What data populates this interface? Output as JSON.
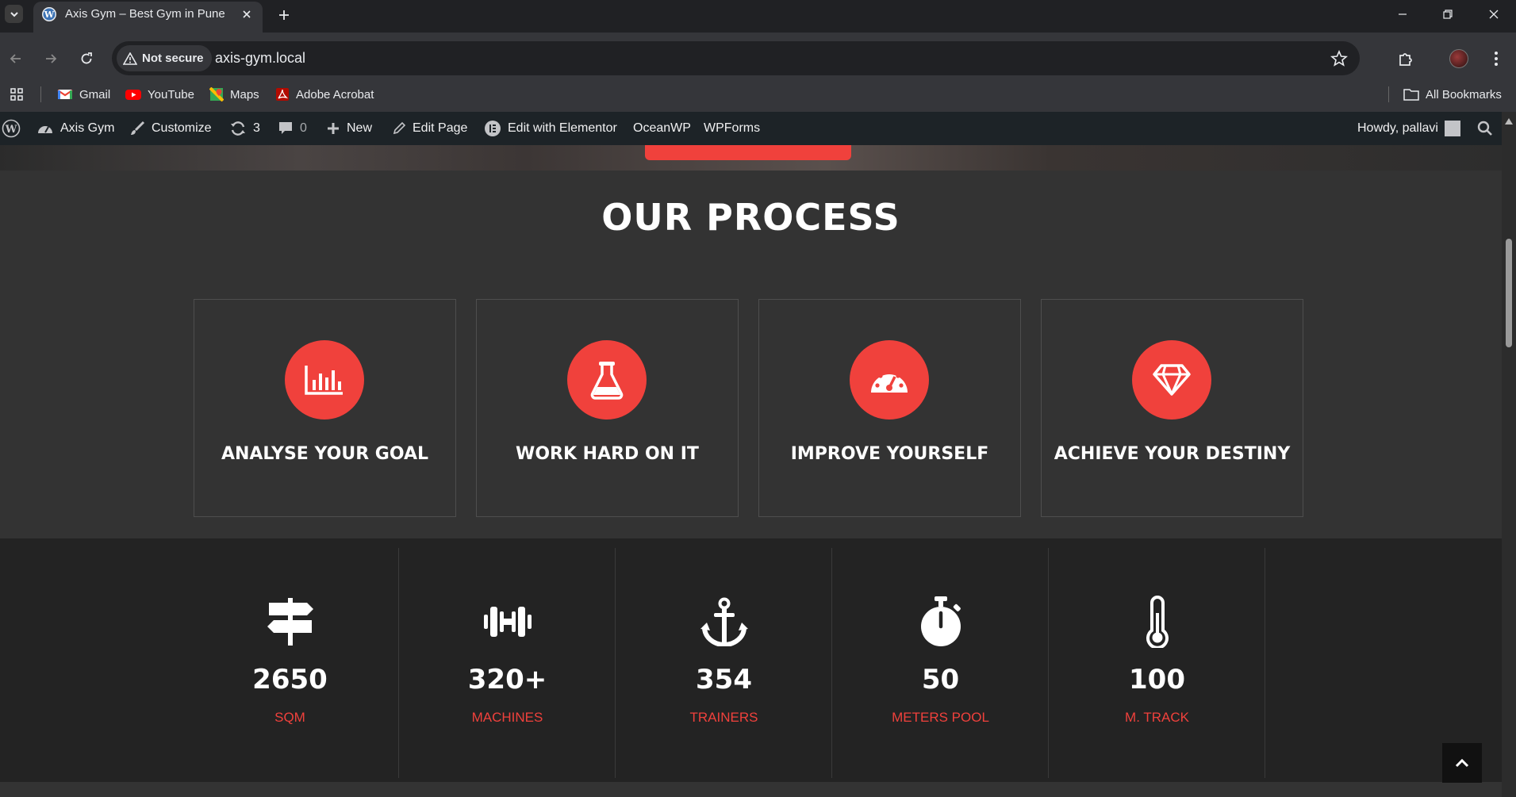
{
  "browser": {
    "tab_title": "Axis Gym – Best Gym in Pune",
    "security_label": "Not secure",
    "url": "axis-gym.local",
    "bookmarks": [
      {
        "label": "Gmail",
        "icon": "gmail-icon"
      },
      {
        "label": "YouTube",
        "icon": "youtube-icon"
      },
      {
        "label": "Maps",
        "icon": "maps-icon"
      },
      {
        "label": "Adobe Acrobat",
        "icon": "acrobat-icon"
      }
    ],
    "all_bookmarks_label": "All Bookmarks"
  },
  "adminbar": {
    "site_name": "Axis Gym",
    "customize": "Customize",
    "updates_count": "3",
    "comments_count": "0",
    "new": "New",
    "edit_page": "Edit Page",
    "edit_elementor": "Edit with Elementor",
    "oceanwp": "OceanWP",
    "wpforms": "WPForms",
    "howdy": "Howdy, pallavi"
  },
  "process": {
    "title": "OUR PROCESS",
    "cards": [
      {
        "label": "ANALYSE YOUR GOAL",
        "icon": "chart-bar-icon"
      },
      {
        "label": "WORK HARD ON IT",
        "icon": "flask-icon"
      },
      {
        "label": "IMPROVE YOURSELF",
        "icon": "speedometer-icon"
      },
      {
        "label": "ACHIEVE YOUR DESTINY",
        "icon": "diamond-icon"
      }
    ]
  },
  "stats": [
    {
      "value": "2650",
      "label": "SQM",
      "icon": "signpost-icon"
    },
    {
      "value": "320+",
      "label": "MACHINES",
      "icon": "dumbbell-icon"
    },
    {
      "value": "354",
      "label": "TRAINERS",
      "icon": "anchor-icon"
    },
    {
      "value": "50",
      "label": "METERS POOL",
      "icon": "stopwatch-icon"
    },
    {
      "value": "100",
      "label": "M. TRACK",
      "icon": "thermometer-icon"
    }
  ],
  "colors": {
    "accent": "#f0413c",
    "page_bg": "#333333",
    "stats_bg": "#232323",
    "adminbar_bg": "#1d2327"
  }
}
